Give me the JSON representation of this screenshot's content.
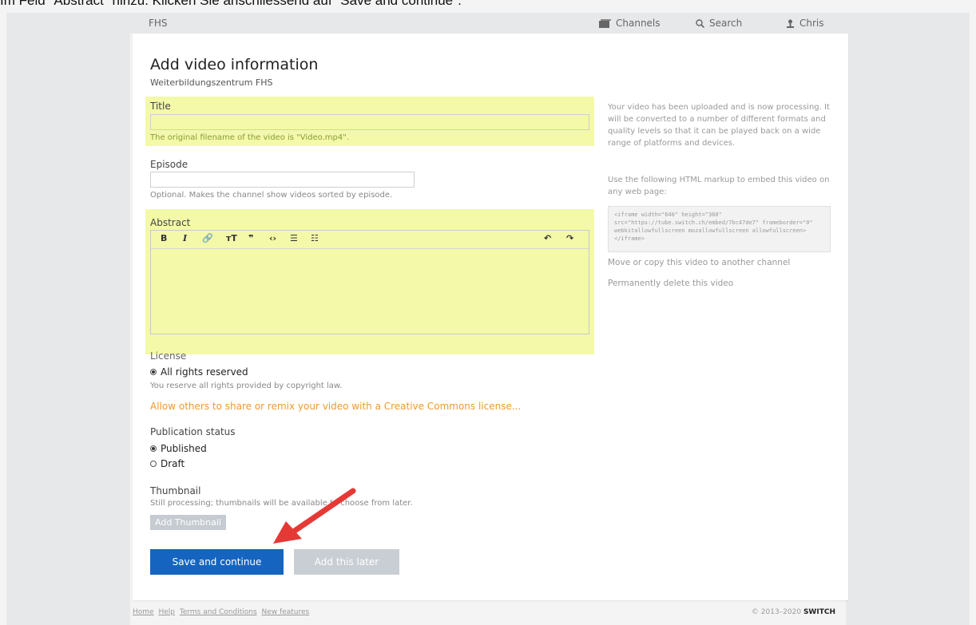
{
  "instruction": "Im Feld \"Abstract\" hinzu. Klicken Sie anschliessend auf \"Save and continue\".",
  "topbar": {
    "brand": "FHS",
    "channels": "Channels",
    "search": "Search",
    "user": "Chris"
  },
  "page": {
    "title": "Add video information",
    "subtitle": "Weiterbildungszentrum FHS"
  },
  "form": {
    "title_label": "Title",
    "title_value": "",
    "title_help": "The original filename of the video is \"Video.mp4\".",
    "episode_label": "Episode",
    "episode_value": "",
    "episode_help": "Optional. Makes the channel show videos sorted by episode.",
    "abstract_label": "Abstract",
    "toolbar": {
      "bold": "B",
      "italic": "I",
      "link": "🔗",
      "heading": "тT",
      "quote": "❞",
      "code": "‹›",
      "bullets": "☰",
      "numbers": "☷",
      "undo": "↶",
      "redo": "↷"
    },
    "license_label": "License",
    "license_option": "All rights reserved",
    "license_help": "You reserve all rights provided by copyright law.",
    "license_link": "Allow others to share or remix your video with a Creative Commons license...",
    "publication_label": "Publication status",
    "publication_options": [
      "Published",
      "Draft"
    ],
    "thumbnail_label": "Thumbnail",
    "thumbnail_help": "Still processing; thumbnails will be available to choose from later.",
    "thumbnail_button": "Add Thumbnail",
    "save_button": "Save and continue",
    "later_button": "Add this later"
  },
  "sidebar": {
    "processing_text": "Your video has been uploaded and is now processing. It will be converted to a number of different formats and quality levels so that it can be played back on a wide range of platforms and devices.",
    "embed_text": "Use the following HTML markup to embed this video on any web page:",
    "embed_code": "<iframe width=\"640\" height=\"360\" src=\"https://tube.switch.ch/embed/7bc47de7\" frameborder=\"0\" webkitallowfullscreen mozallowfullscreen allowfullscreen></iframe>",
    "move_link": "Move or copy this video to another channel",
    "delete_link": "Permanently delete this video"
  },
  "footer": {
    "links": [
      "Home",
      "Help",
      "Terms and Conditions",
      "New features"
    ],
    "copyright": "© 2013–2020",
    "brand": "SWITCH"
  },
  "colors": {
    "highlight": "#f3f9a8",
    "primary": "#1565c0",
    "link_orange": "#ee9a2e",
    "delete_red": "#d8262c",
    "arrow_red": "#e53935"
  },
  "icons": {
    "channels": "channels-icon",
    "search": "search-icon",
    "user": "user-icon",
    "arrow": "arrow-annotation-icon"
  }
}
